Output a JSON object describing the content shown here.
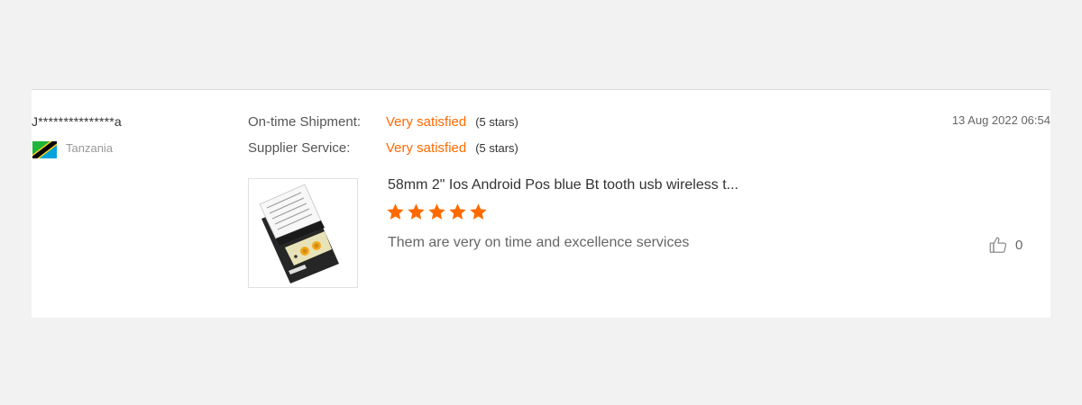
{
  "review": {
    "user_name": "J***************a",
    "country": "Tanzania",
    "flag_icon": "tanzania-flag-icon",
    "date": "13 Aug 2022 06:54",
    "ratings": [
      {
        "label": "On-time Shipment:",
        "value": "Very satisfied",
        "stars": "(5 stars)"
      },
      {
        "label": "Supplier Service:",
        "value": "Very satisfied",
        "stars": "(5 stars)"
      }
    ],
    "product": {
      "title": "58mm 2\" Ios Android Pos blue Bt tooth usb wireless t...",
      "image_icon": "receipt-printer-image",
      "star_rating": 5
    },
    "review_text": "Them are very on time and excellence  services",
    "like_icon": "thumbs-up-icon",
    "like_count": "0"
  },
  "colors": {
    "accent": "#ff6a00",
    "background": "#f2f2f2",
    "card": "#ffffff"
  }
}
